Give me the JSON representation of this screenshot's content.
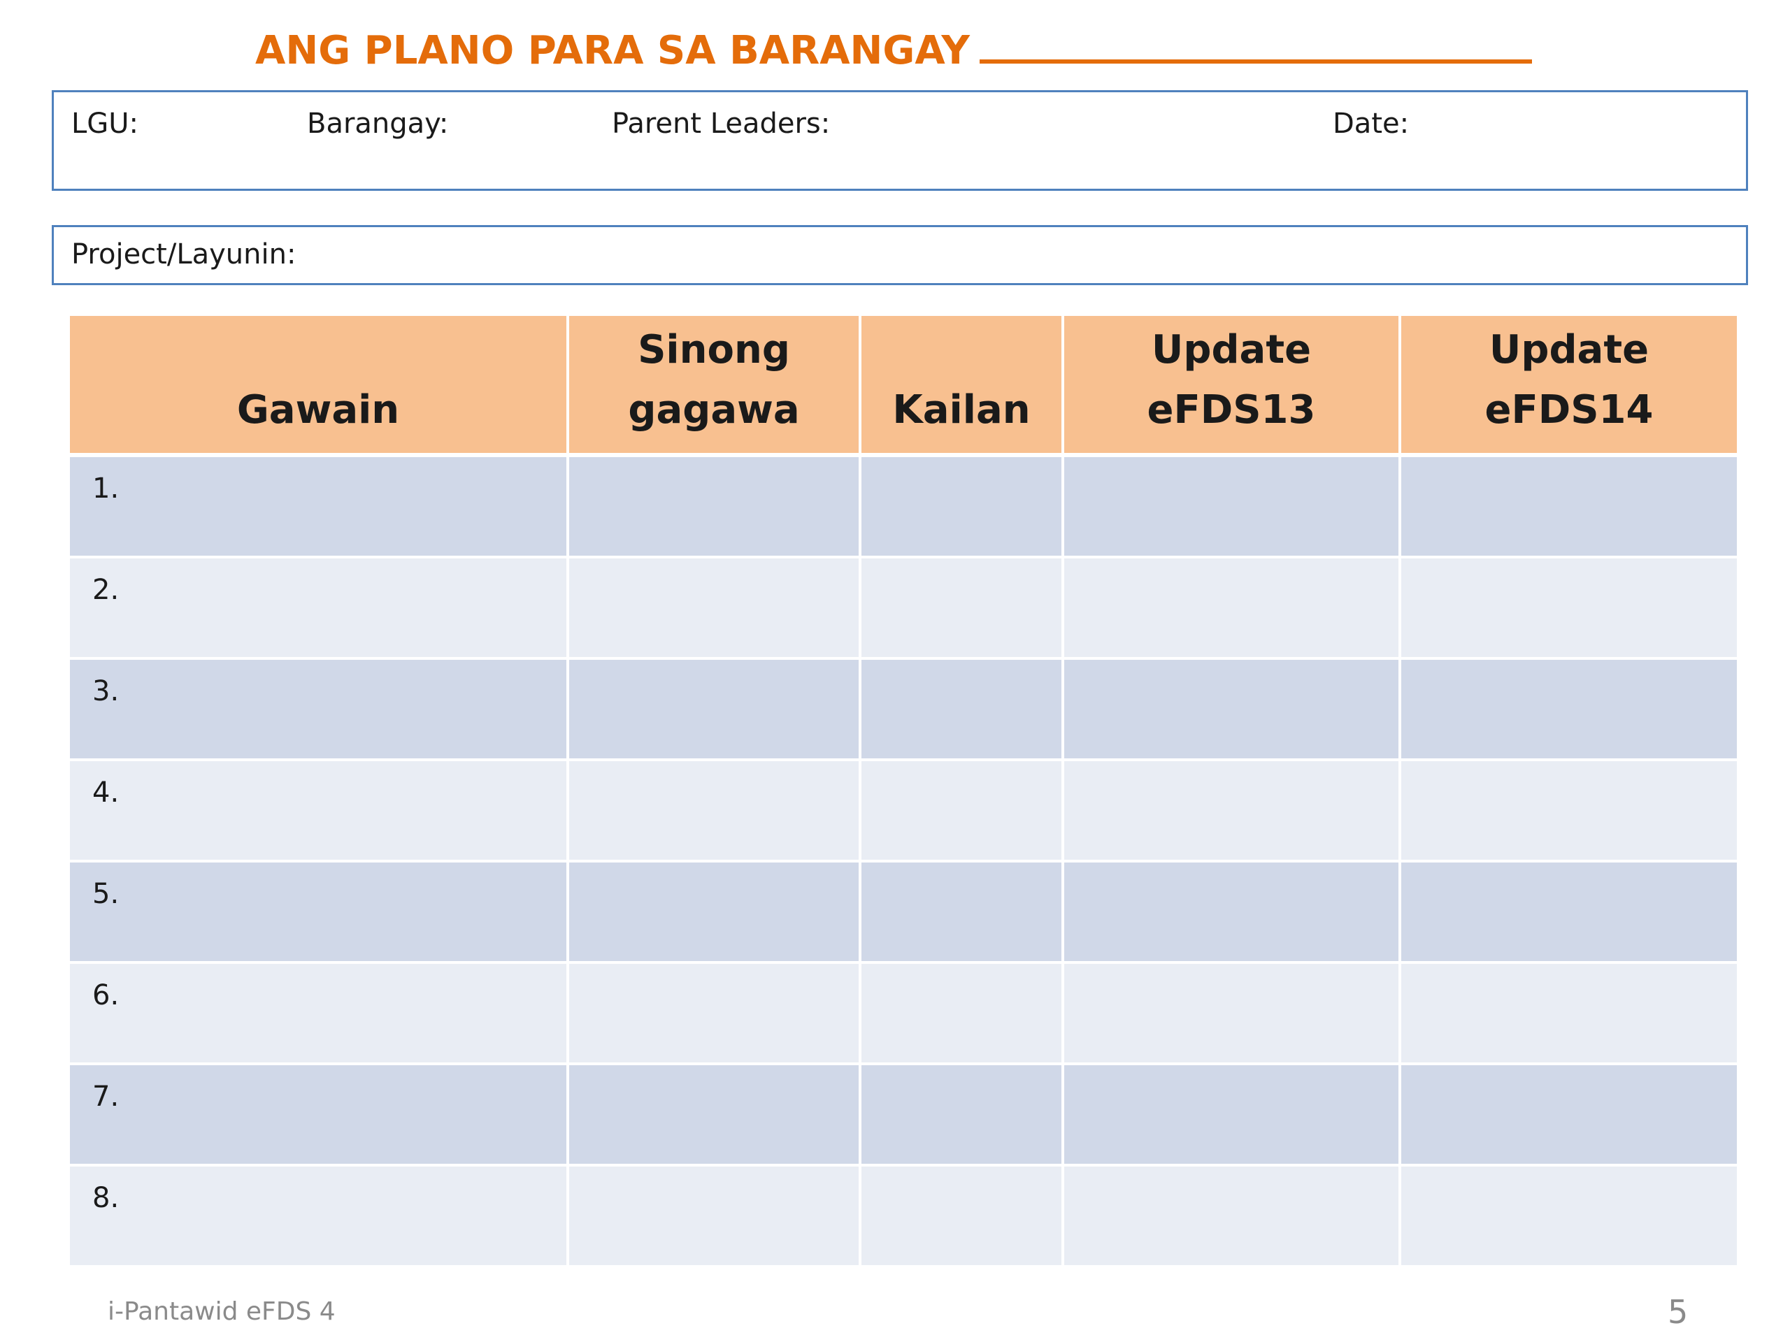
{
  "title": "ANG PLANO PARA SA BARANGAY",
  "info_fields": {
    "lgu": "LGU:",
    "barangay": "Barangay:",
    "parent_leaders": "Parent Leaders:",
    "date": "Date:"
  },
  "project_label": "Project/Layunin:",
  "table": {
    "headers": [
      "Gawain",
      "Sinong\ngagawa",
      "Kailan",
      "Update\neFDS13",
      "Update\neFDS14"
    ],
    "rows": [
      {
        "num": "1."
      },
      {
        "num": "2."
      },
      {
        "num": "3."
      },
      {
        "num": "4."
      },
      {
        "num": "5."
      },
      {
        "num": "6."
      },
      {
        "num": "7."
      },
      {
        "num": "8."
      }
    ]
  },
  "footer": {
    "left": "i-Pantawid eFDS 4",
    "page_number": "5"
  },
  "colors": {
    "title": "#e46c0a",
    "box_border": "#4f81bd",
    "header_fill": "#f8c090",
    "row_dark": "#d0d8e8",
    "row_light": "#e9edf4",
    "footer_text": "#8a8a8a"
  }
}
